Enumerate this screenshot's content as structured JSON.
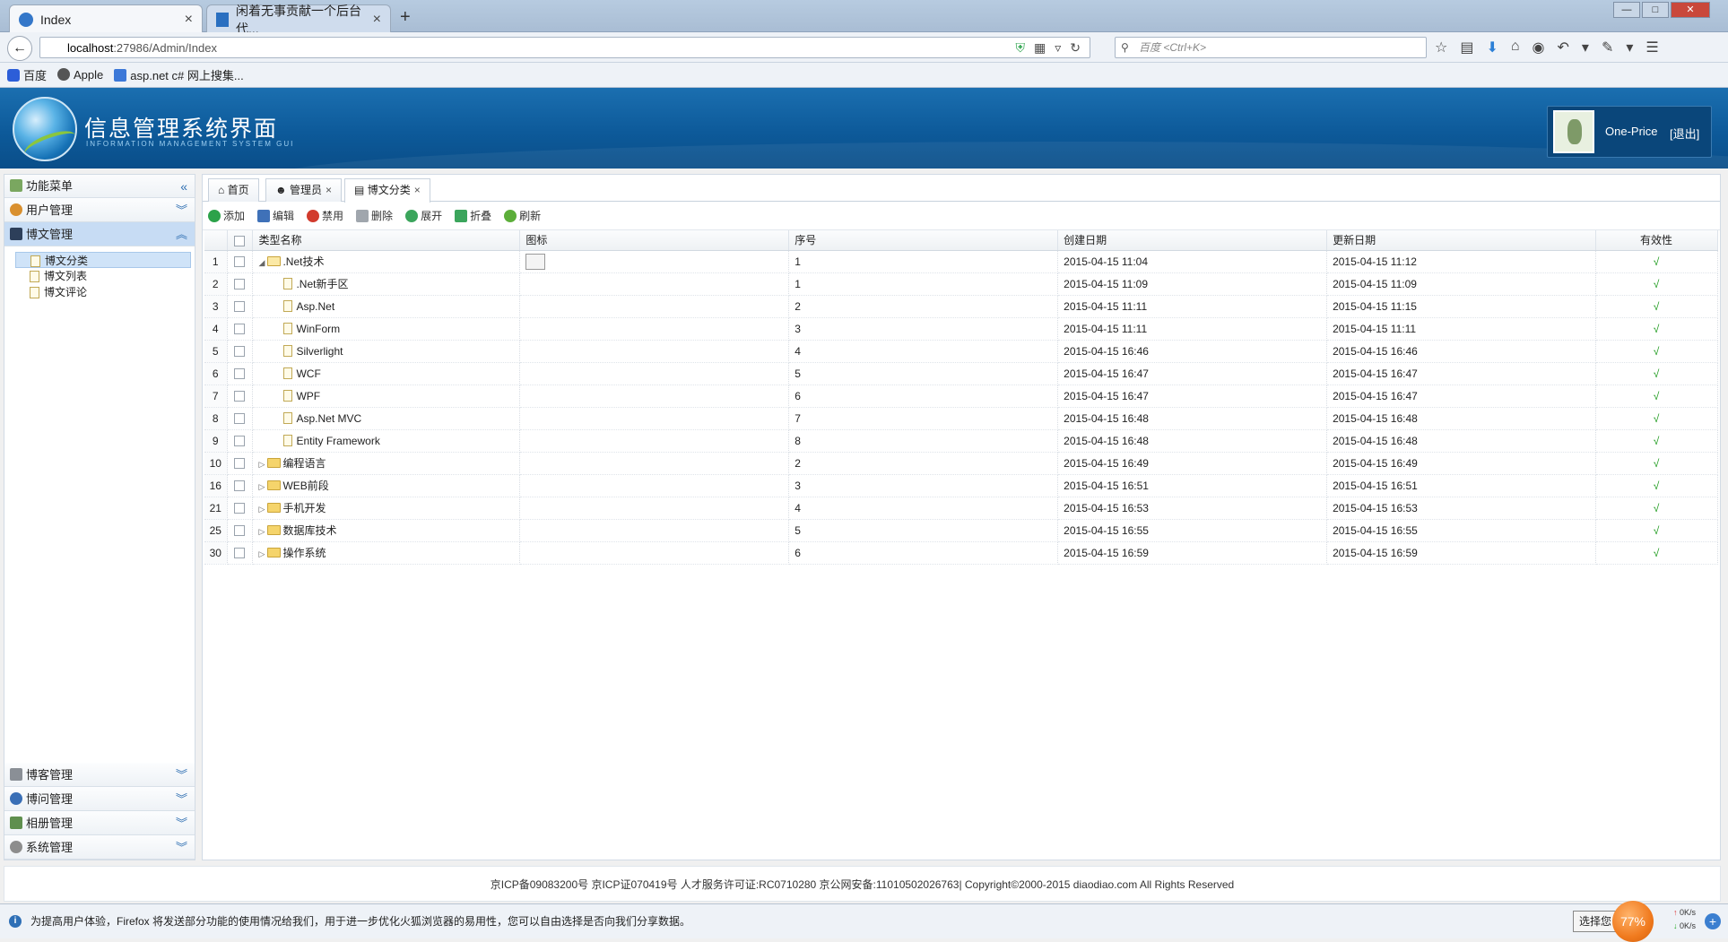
{
  "browser": {
    "tabs": [
      {
        "title": "Index"
      },
      {
        "title": "闲着无事贡献一个后台代..."
      }
    ],
    "url_host": "localhost",
    "url_rest": ":27986/Admin/Index",
    "search_placeholder": "百度 <Ctrl+K>",
    "bookmarks": [
      "百度",
      "Apple",
      "asp.net c# 网上搜集..."
    ]
  },
  "header": {
    "title": "信息管理系统界面",
    "subtitle": "INFORMATION MANAGEMENT SYSTEM GUI",
    "user": "One-Price",
    "logout": "[退出]"
  },
  "sidebar": {
    "title": "功能菜单",
    "top_sections": [
      {
        "label": "用户管理"
      },
      {
        "label": "博文管理"
      }
    ],
    "tree": [
      {
        "label": "博文分类"
      },
      {
        "label": "博文列表"
      },
      {
        "label": "博文评论"
      }
    ],
    "bottom_sections": [
      {
        "label": "博客管理"
      },
      {
        "label": "博问管理"
      },
      {
        "label": "相册管理"
      },
      {
        "label": "系统管理"
      }
    ]
  },
  "tabs": [
    {
      "label": "首页"
    },
    {
      "label": "管理员"
    },
    {
      "label": "博文分类"
    }
  ],
  "toolbar": {
    "add": "添加",
    "edit": "编辑",
    "disable": "禁用",
    "delete": "删除",
    "expand": "展开",
    "collapse": "折叠",
    "refresh": "刷新"
  },
  "grid": {
    "columns": {
      "name": "类型名称",
      "icon": "图标",
      "order": "序号",
      "created": "创建日期",
      "updated": "更新日期",
      "valid": "有效性"
    },
    "rows": [
      {
        "rn": "1",
        "name": ".Net技术",
        "order": "1",
        "created": "2015-04-15 11:04",
        "updated": "2015-04-15 11:12",
        "valid": "√"
      },
      {
        "rn": "2",
        "name": ".Net新手区",
        "order": "1",
        "created": "2015-04-15 11:09",
        "updated": "2015-04-15 11:09",
        "valid": "√"
      },
      {
        "rn": "3",
        "name": "Asp.Net",
        "order": "2",
        "created": "2015-04-15 11:11",
        "updated": "2015-04-15 11:15",
        "valid": "√"
      },
      {
        "rn": "4",
        "name": "WinForm",
        "order": "3",
        "created": "2015-04-15 11:11",
        "updated": "2015-04-15 11:11",
        "valid": "√"
      },
      {
        "rn": "5",
        "name": "Silverlight",
        "order": "4",
        "created": "2015-04-15 16:46",
        "updated": "2015-04-15 16:46",
        "valid": "√"
      },
      {
        "rn": "6",
        "name": "WCF",
        "order": "5",
        "created": "2015-04-15 16:47",
        "updated": "2015-04-15 16:47",
        "valid": "√"
      },
      {
        "rn": "7",
        "name": "WPF",
        "order": "6",
        "created": "2015-04-15 16:47",
        "updated": "2015-04-15 16:47",
        "valid": "√"
      },
      {
        "rn": "8",
        "name": "Asp.Net MVC",
        "order": "7",
        "created": "2015-04-15 16:48",
        "updated": "2015-04-15 16:48",
        "valid": "√"
      },
      {
        "rn": "9",
        "name": "Entity Framework",
        "order": "8",
        "created": "2015-04-15 16:48",
        "updated": "2015-04-15 16:48",
        "valid": "√"
      },
      {
        "rn": "10",
        "name": "编程语言",
        "order": "2",
        "created": "2015-04-15 16:49",
        "updated": "2015-04-15 16:49",
        "valid": "√"
      },
      {
        "rn": "16",
        "name": "WEB前段",
        "order": "3",
        "created": "2015-04-15 16:51",
        "updated": "2015-04-15 16:51",
        "valid": "√"
      },
      {
        "rn": "21",
        "name": "手机开发",
        "order": "4",
        "created": "2015-04-15 16:53",
        "updated": "2015-04-15 16:53",
        "valid": "√"
      },
      {
        "rn": "25",
        "name": "数据库技术",
        "order": "5",
        "created": "2015-04-15 16:55",
        "updated": "2015-04-15 16:55",
        "valid": "√"
      },
      {
        "rn": "30",
        "name": "操作系统",
        "order": "6",
        "created": "2015-04-15 16:59",
        "updated": "2015-04-15 16:59",
        "valid": "√"
      }
    ]
  },
  "footer": "京ICP备09083200号 京ICP证070419号 人才服务许可证:RC0710280 京公网安备:11010502026763| Copyright©2000-2015 diaodiao.com All Rights Reserved",
  "notification": {
    "text": "为提高用户体验，Firefox 将发送部分功能的使用情况给我们，用于进一步优化火狐浏览器的易用性，您可以自由选择是否向我们分享数据。",
    "button": "选择您",
    "speed_percent": "77%",
    "up": "0K/s",
    "down": "0K/s"
  },
  "colors": {
    "header_blue": "#0d5a9a",
    "accent_link": "#2f6fb2",
    "selected_bg": "#c7dcf4",
    "valid_green": "#1a9a1a"
  }
}
